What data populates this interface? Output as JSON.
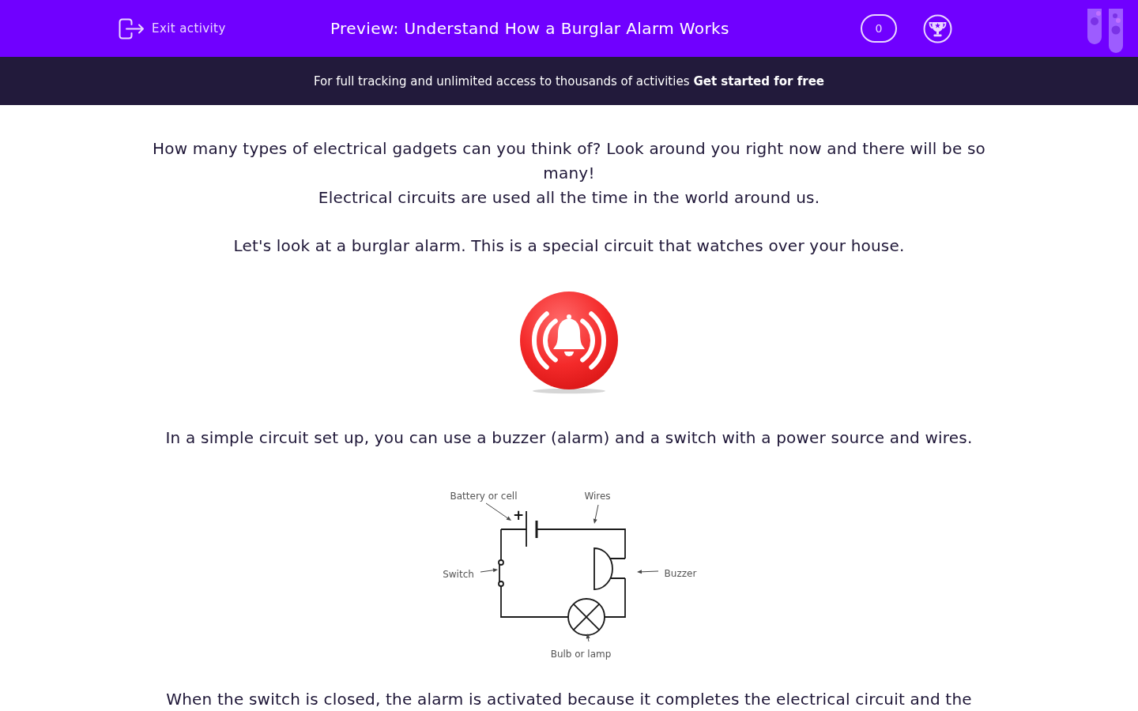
{
  "header": {
    "exit_label": "Exit activity",
    "title": "Preview: Understand How a Burglar Alarm Works",
    "score": "0"
  },
  "banner": {
    "message": "For full tracking and unlimited access to thousands of activities",
    "link": "Get started for free"
  },
  "content": [
    {
      "kind": "text",
      "lines": [
        "How many types of electrical gadgets can you think of? Look around you right now and there will be so many!",
        "Electrical circuits are used all the time in the world around us."
      ]
    },
    {
      "kind": "text",
      "lines": [
        "Let's look at a burglar alarm. This is a special circuit that watches over your house."
      ]
    },
    {
      "kind": "alarm_picture"
    },
    {
      "kind": "text",
      "lines": [
        "In a simple circuit set up, you can use a buzzer (alarm) and a switch with a power source and wires."
      ]
    },
    {
      "kind": "circuit_diagram",
      "polarity": "+",
      "labels": {
        "battery": "Battery or cell",
        "wires": "Wires",
        "switch": "Switch",
        "buzzer": "Buzzer",
        "bulb": "Bulb or lamp"
      }
    },
    {
      "kind": "text",
      "lines": [
        "When the switch is closed, the alarm is activated because it completes the electrical circuit and the"
      ]
    }
  ]
}
